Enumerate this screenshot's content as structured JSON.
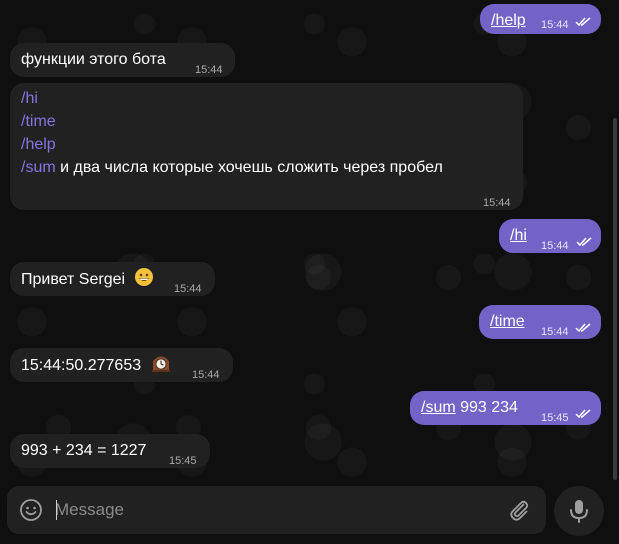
{
  "messages": [
    {
      "dir": "out",
      "parts": [
        {
          "text": "/help",
          "cmd": true
        }
      ],
      "time": "15:44"
    },
    {
      "dir": "in",
      "parts": [
        {
          "text": "функции этого бота"
        }
      ],
      "time": "15:44"
    },
    {
      "dir": "in",
      "lines": [
        "/hi",
        "/time",
        "/help"
      ],
      "last_cmd": "/sum",
      "last_text": " и два числа которые хочешь сложить через пробел",
      "time": "15:44"
    },
    {
      "dir": "out",
      "parts": [
        {
          "text": "/hi",
          "cmd": true
        }
      ],
      "time": "15:44"
    },
    {
      "dir": "in",
      "parts": [
        {
          "text": "Привет Sergei"
        }
      ],
      "emoji": "grinning-face",
      "time": "15:44"
    },
    {
      "dir": "out",
      "parts": [
        {
          "text": "/time",
          "cmd": true
        }
      ],
      "time": "15:44"
    },
    {
      "dir": "in",
      "parts": [
        {
          "text": "15:44:50.277653"
        }
      ],
      "emoji": "mantelpiece-clock",
      "time": "15:44"
    },
    {
      "dir": "out",
      "parts": [
        {
          "text": "/sum",
          "cmd": true
        },
        {
          "text": " 993 234"
        }
      ],
      "time": "15:45"
    },
    {
      "dir": "in",
      "parts": [
        {
          "text": "993 + 234 = 1227"
        }
      ],
      "time": "15:45"
    }
  ],
  "composer": {
    "placeholder": "Message",
    "emoji_icon": "smiley-icon",
    "attach_icon": "paperclip-icon",
    "mic_icon": "microphone-icon"
  },
  "colors": {
    "outgoing_bubble": "#7463c6",
    "incoming_bubble": "#212121",
    "command_link": "#8774e1"
  }
}
